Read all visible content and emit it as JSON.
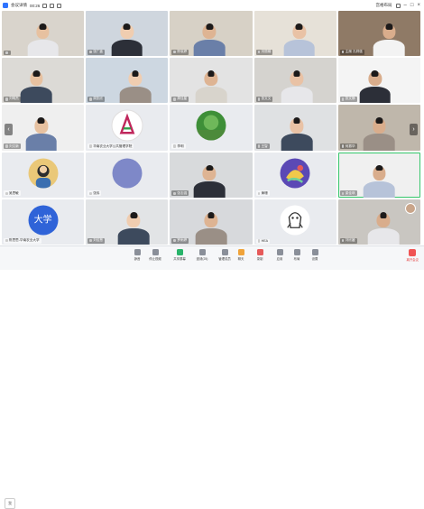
{
  "app": {
    "title": "会议详情",
    "time": "00:26"
  },
  "header": {
    "layout_label": "宫格布局"
  },
  "participants": [
    {
      "name": "",
      "kind": "video"
    },
    {
      "name": "张广鑫",
      "kind": "video"
    },
    {
      "name": "陈晓婷",
      "kind": "video"
    },
    {
      "name": "刘丽娟",
      "kind": "video"
    },
    {
      "name": "主席 孔祥强",
      "kind": "video"
    },
    {
      "name": "刘明杰",
      "kind": "video"
    },
    {
      "name": "周凯欣",
      "kind": "video"
    },
    {
      "name": "周佳星",
      "kind": "video"
    },
    {
      "name": "张文文",
      "kind": "video"
    },
    {
      "name": "张文静",
      "kind": "video"
    },
    {
      "name": "刘文新",
      "kind": "video"
    },
    {
      "name": "华南农业大学公共管理学院",
      "kind": "avatar"
    },
    {
      "name": "李明",
      "kind": "avatar"
    },
    {
      "name": "王智",
      "kind": "video"
    },
    {
      "name": "何振华",
      "kind": "video"
    },
    {
      "name": "吴思敏",
      "kind": "avatar"
    },
    {
      "name": "张伟",
      "kind": "avatar"
    },
    {
      "name": "张志强",
      "kind": "video"
    },
    {
      "name": "黄珊",
      "kind": "avatar"
    },
    {
      "name": "梁佳琪",
      "kind": "video"
    },
    {
      "name": "陈思思-华南农业大学",
      "kind": "avatar",
      "avatar_text": "大学"
    },
    {
      "name": "刘佳慧",
      "kind": "video"
    },
    {
      "name": "罗雨婷",
      "kind": "video"
    },
    {
      "name": "HEA",
      "kind": "avatar"
    },
    {
      "name": "刘欣媛",
      "kind": "video"
    }
  ],
  "toolbar": {
    "items": [
      {
        "label": "静音",
        "icon": "mic-icon"
      },
      {
        "label": "停止视频",
        "icon": "camera-icon"
      },
      {
        "label": "共享屏幕",
        "icon": "share-screen-icon"
      },
      {
        "label": "邀请(25)",
        "icon": "participants-icon"
      },
      {
        "label": "管理成员",
        "icon": "manage-icon"
      },
      {
        "label": "聊天",
        "icon": "chat-icon"
      },
      {
        "label": "录制",
        "icon": "record-icon"
      },
      {
        "label": "应用",
        "icon": "apps-icon"
      },
      {
        "label": "布局",
        "icon": "layout-icon"
      },
      {
        "label": "设置",
        "icon": "settings-icon"
      }
    ],
    "leave_label": "离开会议",
    "self_label": "我"
  },
  "colors": {
    "accent": "#2f74ff",
    "active_border": "#35c66b",
    "leave": "#f05454"
  }
}
